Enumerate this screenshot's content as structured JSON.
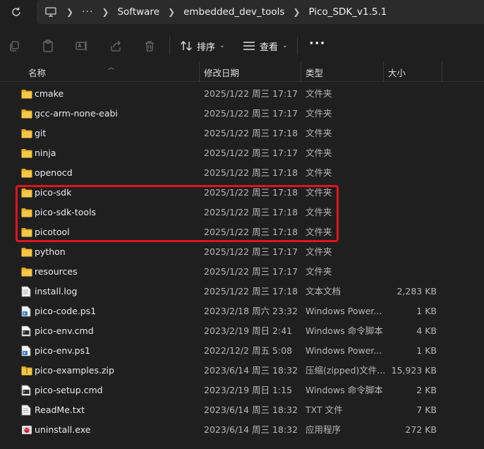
{
  "address": {
    "more": "···",
    "crumbs": [
      "Software",
      "embedded_dev_tools",
      "Pico_SDK_v1.5.1"
    ]
  },
  "toolbar": {
    "sort_label": "排序",
    "view_label": "查看",
    "more": "···"
  },
  "columns": {
    "name": "名称",
    "date": "修改日期",
    "type": "类型",
    "size": "大小"
  },
  "files": [
    {
      "name": "cmake",
      "date": "2025/1/22 周三 17:17",
      "type": "文件夹",
      "size": "",
      "icon": "folder-icon"
    },
    {
      "name": "gcc-arm-none-eabi",
      "date": "2025/1/22 周三 17:17",
      "type": "文件夹",
      "size": "",
      "icon": "folder-icon"
    },
    {
      "name": "git",
      "date": "2025/1/22 周三 17:18",
      "type": "文件夹",
      "size": "",
      "icon": "folder-icon"
    },
    {
      "name": "ninja",
      "date": "2025/1/22 周三 17:17",
      "type": "文件夹",
      "size": "",
      "icon": "folder-icon"
    },
    {
      "name": "openocd",
      "date": "2025/1/22 周三 17:18",
      "type": "文件夹",
      "size": "",
      "icon": "folder-icon"
    },
    {
      "name": "pico-sdk",
      "date": "2025/1/22 周三 17:18",
      "type": "文件夹",
      "size": "",
      "icon": "folder-icon"
    },
    {
      "name": "pico-sdk-tools",
      "date": "2025/1/22 周三 17:18",
      "type": "文件夹",
      "size": "",
      "icon": "folder-icon"
    },
    {
      "name": "picotool",
      "date": "2025/1/22 周三 17:18",
      "type": "文件夹",
      "size": "",
      "icon": "folder-icon"
    },
    {
      "name": "python",
      "date": "2025/1/22 周三 17:17",
      "type": "文件夹",
      "size": "",
      "icon": "folder-icon"
    },
    {
      "name": "resources",
      "date": "2025/1/22 周三 17:17",
      "type": "文件夹",
      "size": "",
      "icon": "folder-icon"
    },
    {
      "name": "install.log",
      "date": "2025/1/22 周三 17:18",
      "type": "文本文档",
      "size": "2,283 KB",
      "icon": "text-file-icon"
    },
    {
      "name": "pico-code.ps1",
      "date": "2023/2/18 周六 23:32",
      "type": "Windows Power...",
      "size": "1 KB",
      "icon": "powershell-script-icon"
    },
    {
      "name": "pico-env.cmd",
      "date": "2023/2/19 周日 2:41",
      "type": "Windows 命令脚本",
      "size": "4 KB",
      "icon": "cmd-script-icon"
    },
    {
      "name": "pico-env.ps1",
      "date": "2022/12/2 周五 5:08",
      "type": "Windows Power...",
      "size": "1 KB",
      "icon": "powershell-script-icon"
    },
    {
      "name": "pico-examples.zip",
      "date": "2023/6/14 周三 18:32",
      "type": "压缩(zipped)文件...",
      "size": "15,923 KB",
      "icon": "zip-folder-icon"
    },
    {
      "name": "pico-setup.cmd",
      "date": "2023/2/19 周日 1:15",
      "type": "Windows 命令脚本",
      "size": "2 KB",
      "icon": "cmd-script-icon"
    },
    {
      "name": "ReadMe.txt",
      "date": "2023/6/14 周三 18:32",
      "type": "TXT 文件",
      "size": "7 KB",
      "icon": "text-file-icon"
    },
    {
      "name": "uninstall.exe",
      "date": "2023/6/14 周三 18:32",
      "type": "应用程序",
      "size": "272 KB",
      "icon": "exe-icon"
    }
  ],
  "colors": {
    "highlight": "#e0141b",
    "folder": "#f3c33f",
    "background": "#1f1f1f"
  }
}
